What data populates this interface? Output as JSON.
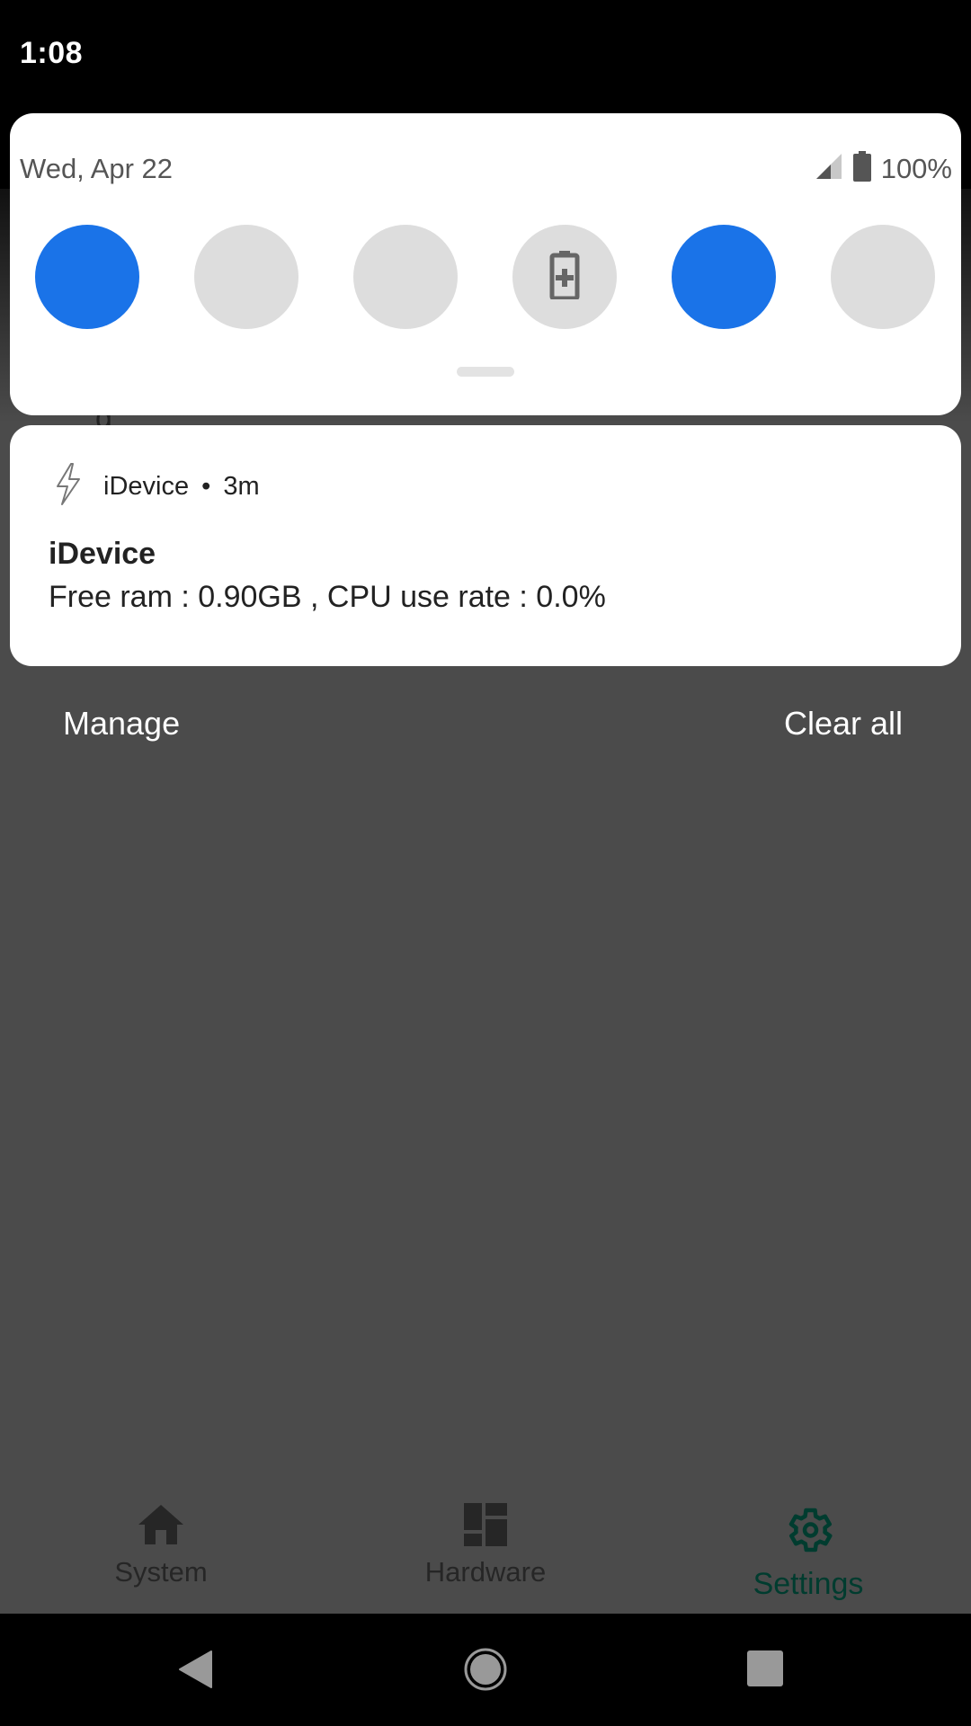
{
  "status_bar": {
    "time": "1:08"
  },
  "quick_settings": {
    "date": "Wed, Apr 22",
    "battery_percent": "100%",
    "signal_icon": "cellular-signal-icon",
    "battery_icon": "battery-full-icon",
    "tiles": [
      {
        "name": "quick-tile-1",
        "state": "on",
        "icon": ""
      },
      {
        "name": "quick-tile-2",
        "state": "off",
        "icon": ""
      },
      {
        "name": "quick-tile-3",
        "state": "off",
        "icon": ""
      },
      {
        "name": "battery-saver-tile",
        "state": "off",
        "icon": "battery-saver-icon"
      },
      {
        "name": "quick-tile-5",
        "state": "on",
        "icon": ""
      },
      {
        "name": "quick-tile-6",
        "state": "off",
        "icon": ""
      }
    ]
  },
  "notification": {
    "app_icon": "lightning-bolt-icon",
    "app_name": "iDevice",
    "separator": "•",
    "time_ago": "3m",
    "title": "iDevice",
    "text": "Free ram : 0.90GB , CPU use rate : 0.0%"
  },
  "shade_actions": {
    "manage": "Manage",
    "clear_all": "Clear all"
  },
  "bottom_nav": {
    "items": [
      {
        "label": "System",
        "icon": "home-icon",
        "active": false
      },
      {
        "label": "Hardware",
        "icon": "dashboard-icon",
        "active": false
      },
      {
        "label": "Settings",
        "icon": "gear-icon",
        "active": true
      }
    ]
  },
  "system_nav": {
    "back": "back-icon",
    "home": "home-circle-icon",
    "recents": "recents-icon"
  },
  "colors": {
    "tile_on": "#1a73e8",
    "tile_off": "#dddddd",
    "scrim": "#4b4b4b",
    "active_nav": "#003c2f"
  }
}
